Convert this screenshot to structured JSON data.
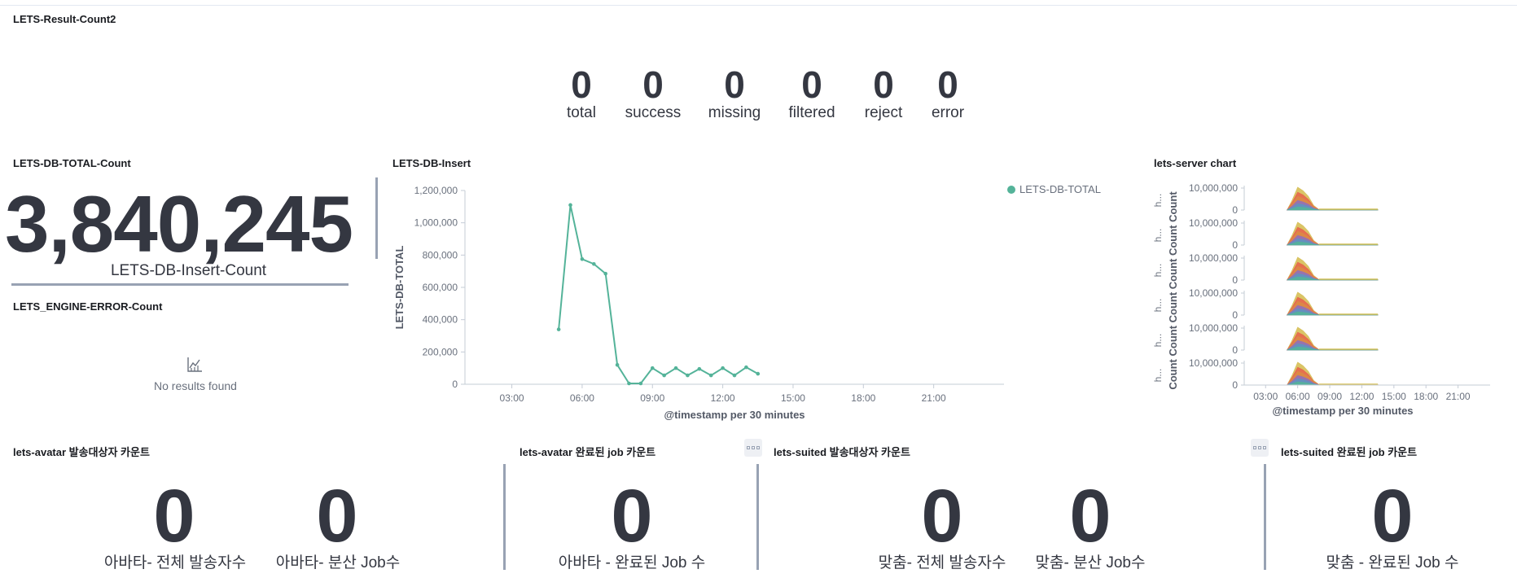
{
  "result_panel": {
    "title": "LETS-Result-Count2",
    "stats": [
      {
        "value": "0",
        "label": "total"
      },
      {
        "value": "0",
        "label": "success"
      },
      {
        "value": "0",
        "label": "missing"
      },
      {
        "value": "0",
        "label": "filtered"
      },
      {
        "value": "0",
        "label": "reject"
      },
      {
        "value": "0",
        "label": "error"
      }
    ]
  },
  "db_total_panel": {
    "title": "LETS-DB-TOTAL-Count",
    "value": "3,840,245",
    "label": "LETS-DB-Insert-Count"
  },
  "engine_error_panel": {
    "title": "LETS_ENGINE-ERROR-Count",
    "empty_icon": "chart-empty-icon",
    "empty_text": "No results found"
  },
  "db_insert_panel": {
    "title": "LETS-DB-Insert"
  },
  "server_chart_panel": {
    "title": "lets-server chart"
  },
  "chart_data": [
    {
      "type": "line",
      "title": "LETS-DB-Insert",
      "xlabel": "@timestamp per 30 minutes",
      "ylabel": "LETS-DB-TOTAL",
      "ylim": [
        0,
        1200000
      ],
      "yticks": [
        "0",
        "200,000",
        "400,000",
        "600,000",
        "800,000",
        "1,000,000",
        "1,200,000"
      ],
      "xticks": [
        "03:00",
        "06:00",
        "09:00",
        "12:00",
        "15:00",
        "18:00",
        "21:00"
      ],
      "xlim": [
        "01:00",
        "24:00"
      ],
      "legend": "top-right",
      "color": "#54b399",
      "series": [
        {
          "name": "LETS-DB-TOTAL",
          "x": [
            "05:00",
            "05:30",
            "06:00",
            "06:30",
            "07:00",
            "07:30",
            "08:00",
            "08:30",
            "09:00",
            "09:30",
            "10:00",
            "10:30",
            "11:00",
            "11:30",
            "12:00",
            "12:30",
            "13:00",
            "13:30"
          ],
          "values": [
            340000,
            1110000,
            775000,
            745000,
            685000,
            120000,
            5000,
            5000,
            100000,
            55000,
            100000,
            55000,
            95000,
            55000,
            100000,
            55000,
            105000,
            65000
          ]
        }
      ]
    },
    {
      "type": "area",
      "title": "lets-server chart",
      "xlabel": "@timestamp per 30 minutes",
      "ylabel": "Count",
      "row_labels": [
        "h...",
        "h...",
        "h...",
        "h...",
        "h...",
        "h..."
      ],
      "yticks": [
        "0",
        "10,000,000"
      ],
      "xticks": [
        "03:00",
        "06:00",
        "09:00",
        "12:00",
        "15:00",
        "18:00",
        "21:00"
      ],
      "rows": 6,
      "colors": [
        "#d6bf57",
        "#e7664c",
        "#da8b45",
        "#9170b8",
        "#6092c0",
        "#54b399"
      ]
    }
  ],
  "bottom_panels": [
    {
      "title": "lets-avatar 발송대상자 카운트",
      "metrics": [
        {
          "value": "0",
          "label": "아바타- 전체 발송자수"
        },
        {
          "value": "0",
          "label": "아바타- 분산 Job수"
        }
      ]
    },
    {
      "title": "lets-avatar 완료된 job 카운트",
      "metrics": [
        {
          "value": "0",
          "label": "아바타 - 완료된 Job 수"
        }
      ]
    },
    {
      "title": "lets-suited 발송대상자 카운트",
      "metrics": [
        {
          "value": "0",
          "label": "맞춤- 전체 발송자수"
        },
        {
          "value": "0",
          "label": "맞춤- 분산 Job수"
        }
      ]
    },
    {
      "title": "lets-suited 완료된 job 카운트",
      "metrics": [
        {
          "value": "0",
          "label": "맞춤 - 완료된 Job 수"
        }
      ]
    }
  ]
}
